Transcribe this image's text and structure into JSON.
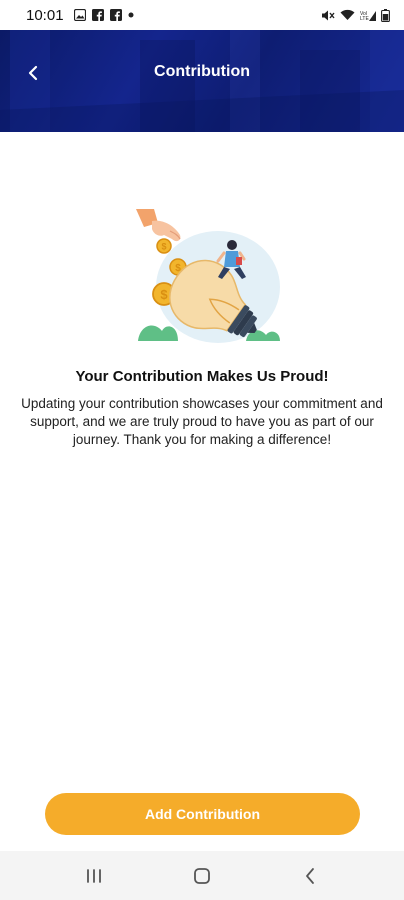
{
  "status_bar": {
    "time": "10:01",
    "left_icons": [
      "image-icon",
      "facebook-icon",
      "facebook-icon",
      "dot-icon"
    ],
    "right_icons": [
      "mute-icon",
      "wifi-icon",
      "signal-icon",
      "battery-icon"
    ]
  },
  "header": {
    "title": "Contribution",
    "back_icon": "chevron-left-icon",
    "background_color": "#14258d"
  },
  "content": {
    "illustration": "hand-dropping-coins-lightbulb-illustration",
    "headline": "Your Contribution Makes Us Proud!",
    "body": "Updating your contribution showcases your commitment and support, and we are truly proud to have you as part of our journey. Thank you for making a difference!"
  },
  "actions": {
    "add_contribution_label": "Add Contribution",
    "button_color": "#f5ac2a"
  },
  "nav_bar": {
    "buttons": [
      "recent-apps-icon",
      "home-icon",
      "back-icon"
    ]
  }
}
